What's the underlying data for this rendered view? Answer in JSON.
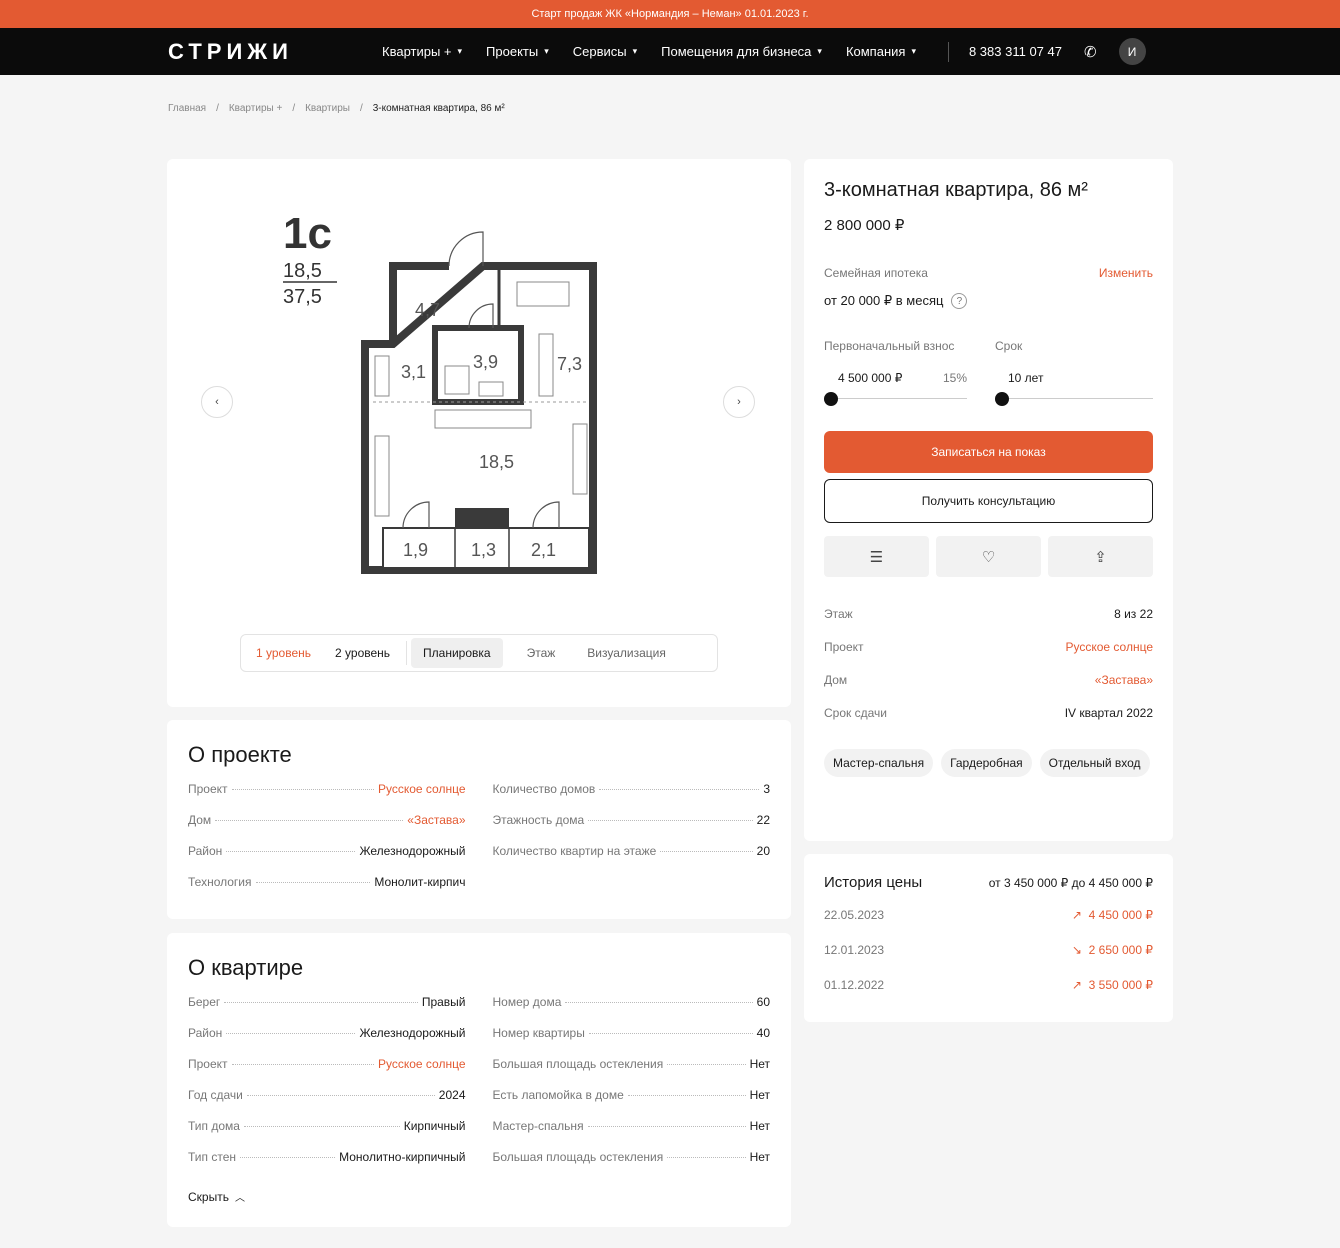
{
  "promo": "Старт продаж ЖК «Нормандия – Неман» 01.01.2023 г.",
  "nav": {
    "logo": "СТРИЖИ",
    "items": [
      {
        "label": "Квартиры +"
      },
      {
        "label": "Проекты"
      },
      {
        "label": "Сервисы"
      },
      {
        "label": "Помещения для бизнеса"
      },
      {
        "label": "Компания"
      }
    ],
    "phone": "8 383 311 07 47",
    "avatar": "И"
  },
  "breadcrumbs": [
    "Главная",
    "Квартиры +",
    "Квартиры",
    "3-комнатная квартира, 86 м²"
  ],
  "plan": {
    "type": "1с",
    "area_living": "18,5",
    "area_total": "37,5",
    "rooms": [
      "4,7",
      "3,9",
      "3,1",
      "7,3",
      "18,5",
      "1,9",
      "1,3",
      "2,1"
    ],
    "tabs": [
      "1 уровень",
      "2 уровень",
      "Планировка",
      "Этаж",
      "Визуализация"
    ]
  },
  "info": {
    "title": "3-комнатная квартира, 86 м²",
    "price": "2 800 000 ₽",
    "mortgage_label": "Семейная ипотека",
    "change": "Изменить",
    "monthly": "от 20 000 ₽ в месяц",
    "down_label": "Первоначальный взнос",
    "term_label": "Срок",
    "down_value": "4 500 000 ₽",
    "down_percent": "15%",
    "term_value": "10 лет",
    "btn_show": "Записаться на показ",
    "btn_consult": "Получить консультацию",
    "details": [
      {
        "k": "Этаж",
        "v": "8 из 22",
        "red": false
      },
      {
        "k": "Проект",
        "v": "Русское солнце",
        "red": true
      },
      {
        "k": "Дом",
        "v": "«Застава»",
        "red": true
      },
      {
        "k": "Срок сдачи",
        "v": "IV квартал 2022",
        "red": false
      }
    ],
    "tags": [
      "Мастер-спальня",
      "Гардеробная",
      "Отдельный вход"
    ]
  },
  "history": {
    "title": "История цены",
    "range": "от 3 450 000 ₽ до 4 450 000 ₽",
    "rows": [
      {
        "date": "22.05.2023",
        "dir": "↗",
        "price": "4 450 000 ₽"
      },
      {
        "date": "12.01.2023",
        "dir": "↘",
        "price": "2 650 000 ₽"
      },
      {
        "date": "01.12.2022",
        "dir": "↗",
        "price": "3 550 000 ₽"
      }
    ]
  },
  "about_project": {
    "title": "О проекте",
    "left": [
      {
        "k": "Проект",
        "v": "Русское солнце",
        "red": true
      },
      {
        "k": "Дом",
        "v": "«Застава»",
        "red": true
      },
      {
        "k": "Район",
        "v": "Железнодорожный",
        "red": false
      },
      {
        "k": "Технология",
        "v": "Монолит-кирпич",
        "red": false
      }
    ],
    "right": [
      {
        "k": "Количество домов",
        "v": "3"
      },
      {
        "k": "Этажность дома",
        "v": "22"
      },
      {
        "k": "Количество квартир на этаже",
        "v": "20"
      }
    ]
  },
  "about_flat": {
    "title": "О квартире",
    "left": [
      {
        "k": "Берег",
        "v": "Правый",
        "red": false
      },
      {
        "k": "Район",
        "v": "Железнодорожный",
        "red": false
      },
      {
        "k": "Проект",
        "v": "Русское солнце",
        "red": true
      },
      {
        "k": "Год сдачи",
        "v": "2024",
        "red": false
      },
      {
        "k": "Тип дома",
        "v": "Кирпичный",
        "red": false
      },
      {
        "k": "Тип стен",
        "v": "Монолитно-кирпичный",
        "red": false
      }
    ],
    "right": [
      {
        "k": "Номер дома",
        "v": "60"
      },
      {
        "k": "Номер квартиры",
        "v": "40"
      },
      {
        "k": "Большая площадь остекления",
        "v": "Нет"
      },
      {
        "k": "Есть лапомойка в доме",
        "v": "Нет"
      },
      {
        "k": "Мастер-спальня",
        "v": "Нет"
      },
      {
        "k": "Большая площадь остекления",
        "v": "Нет"
      }
    ],
    "hide": "Скрыть"
  }
}
